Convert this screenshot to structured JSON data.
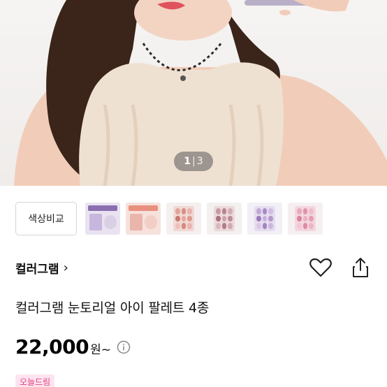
{
  "gallery": {
    "current_page": "1",
    "separator": "|",
    "total_pages": "3"
  },
  "thumbnails": {
    "compare_label": "색상비교",
    "items": [
      "thumbnail-1",
      "thumbnail-2",
      "thumbnail-3",
      "thumbnail-4",
      "thumbnail-5",
      "thumbnail-6"
    ]
  },
  "brand": {
    "name": "컬러그램",
    "chevron": "›"
  },
  "product": {
    "title": "컬러그램 눈토리얼 아이 팔레트 4종",
    "price": "22,000",
    "price_suffix": "원~",
    "badge": "오늘드림"
  },
  "icons": {
    "favorite": "heart-icon",
    "share": "share-icon",
    "info": "info-icon"
  },
  "colors": {
    "badge_bg": "#fde4ef",
    "badge_text": "#e0427f"
  }
}
